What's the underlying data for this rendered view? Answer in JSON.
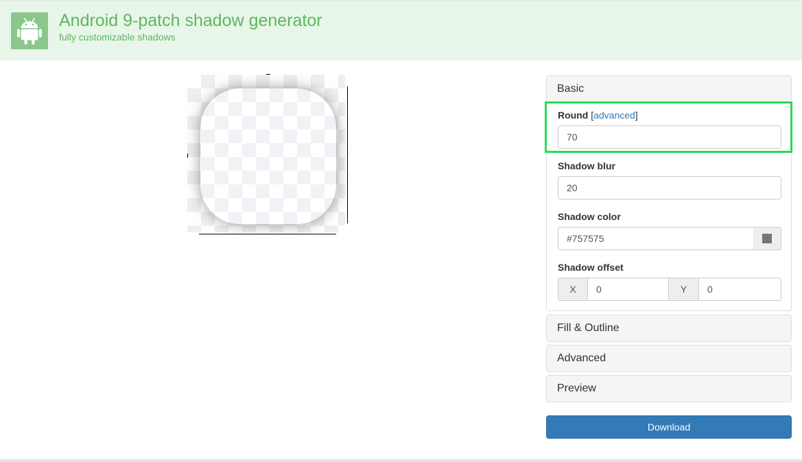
{
  "header": {
    "title": "Android 9-patch shadow generator",
    "subtitle": "fully customizable shadows",
    "logo_icon": "android-icon"
  },
  "colors": {
    "header_bg": "#e8f5e9",
    "brand_green": "#5cb85c",
    "logo_bg": "#8bc78d",
    "primary_button": "#337ab7",
    "highlight": "#22dd55",
    "shadow_color_swatch": "#757575"
  },
  "panels": {
    "basic": {
      "heading": "Basic",
      "round": {
        "label": "Round",
        "bracket_open": "[",
        "advanced_link": "advanced",
        "bracket_close": "]",
        "value": "70"
      },
      "shadow_blur": {
        "label": "Shadow blur",
        "value": "20"
      },
      "shadow_color": {
        "label": "Shadow color",
        "value": "#757575"
      },
      "shadow_offset": {
        "label": "Shadow offset",
        "x_label": "X",
        "x_value": "0",
        "y_label": "Y",
        "y_value": "0"
      }
    },
    "fill_outline": {
      "heading": "Fill & Outline"
    },
    "advanced": {
      "heading": "Advanced"
    },
    "preview": {
      "heading": "Preview"
    }
  },
  "download_button": {
    "label": "Download"
  }
}
